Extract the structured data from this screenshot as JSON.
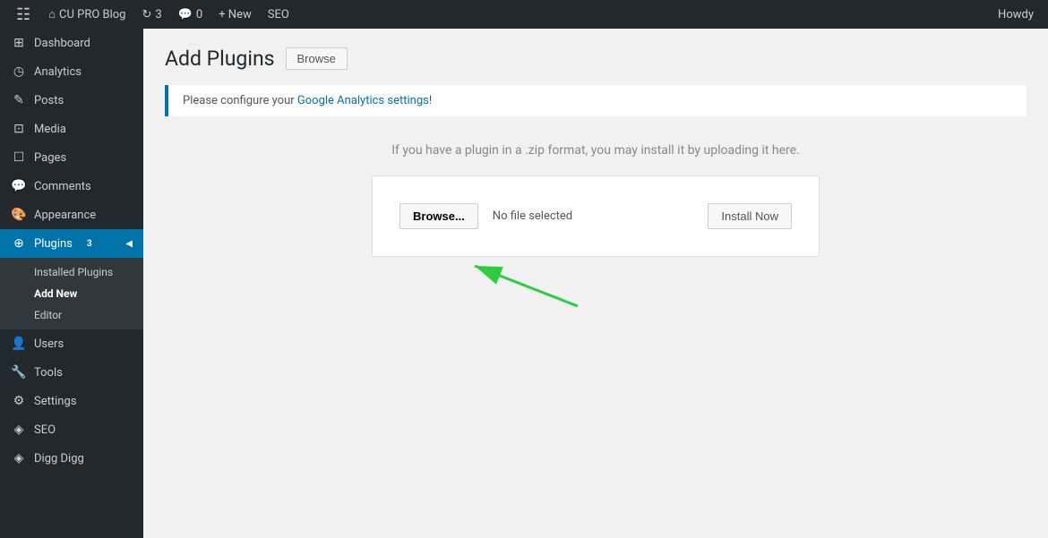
{
  "adminbar": {
    "logo": "⊞",
    "site_name": "CU PRO Blog",
    "updates_count": "3",
    "comments_count": "0",
    "new_label": "+ New",
    "seo_label": "SEO",
    "howdy": "Howdy"
  },
  "sidebar": {
    "items": [
      {
        "id": "dashboard",
        "label": "Dashboard",
        "icon": "⊞"
      },
      {
        "id": "analytics",
        "label": "Analytics",
        "icon": "◷"
      },
      {
        "id": "posts",
        "label": "Posts",
        "icon": "✎"
      },
      {
        "id": "media",
        "label": "Media",
        "icon": "⊡"
      },
      {
        "id": "pages",
        "label": "Pages",
        "icon": "☐"
      },
      {
        "id": "comments",
        "label": "Comments",
        "icon": "💬"
      },
      {
        "id": "appearance",
        "label": "Appearance",
        "icon": "🎨"
      },
      {
        "id": "plugins",
        "label": "Plugins",
        "icon": "⊕",
        "badge": "3"
      },
      {
        "id": "users",
        "label": "Users",
        "icon": "👤"
      },
      {
        "id": "tools",
        "label": "Tools",
        "icon": "🔧"
      },
      {
        "id": "settings",
        "label": "Settings",
        "icon": "⚙"
      },
      {
        "id": "seo",
        "label": "SEO",
        "icon": "◈"
      },
      {
        "id": "diggdigg",
        "label": "Digg Digg",
        "icon": "◈"
      }
    ],
    "plugins_submenu": [
      {
        "id": "installed-plugins",
        "label": "Installed Plugins"
      },
      {
        "id": "add-new",
        "label": "Add New"
      },
      {
        "id": "editor",
        "label": "Editor"
      }
    ]
  },
  "page": {
    "title": "Add Plugins",
    "browse_tab": "Browse",
    "notice_text": "Please configure your ",
    "notice_link_text": "Google Analytics settings",
    "notice_suffix": "!",
    "upload_description": "If you have a plugin in a .zip format, you may install it by uploading it here.",
    "browse_btn": "Browse...",
    "no_file_text": "No file selected",
    "install_btn": "Install Now"
  }
}
